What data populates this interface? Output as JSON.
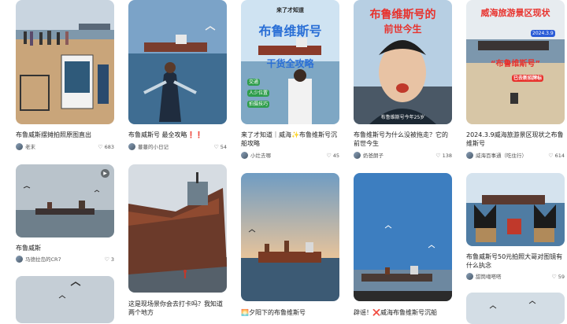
{
  "feed": {
    "columns": [
      {
        "cards": [
          {
            "title": "布鲁威斯摆摊拍照原图直出",
            "author": "老末",
            "likes": "683"
          },
          {
            "title": "布鲁威斯",
            "author": "马德拉岛的CR7",
            "likes": "3"
          },
          {
            "title": "",
            "author": "",
            "likes": ""
          }
        ]
      },
      {
        "cards": [
          {
            "title": "布鲁威斯号 最全攻略❗️❗️",
            "author": "蔓蔓的小日记",
            "likes": "54"
          },
          {
            "title": "这是现场景你会去打卡吗？我知道两个地方",
            "author": "",
            "likes": ""
          }
        ]
      },
      {
        "cards": [
          {
            "title": "来了才知道｜威海✨布鲁维斯号沉船攻略",
            "author": "小灶去哪",
            "likes": "45",
            "overlay": {
              "top": "来了才知道",
              "main": "布鲁维斯号",
              "sub": "干货全攻略",
              "bullets": [
                "交通",
                "人少位置",
                "拍摄技巧"
              ]
            }
          },
          {
            "title": "🌅夕阳下的布鲁维斯号",
            "author": "",
            "likes": ""
          }
        ]
      },
      {
        "cards": [
          {
            "title": "布鲁维斯号为什么没被拖走？它的前世今生",
            "author": "奶爸朗子",
            "likes": "138",
            "overlay": {
              "main": "布鲁维斯号的",
              "sub": "前世今生",
              "caption": "布鲁维斯号今年25岁"
            }
          },
          {
            "title": "辟谣！❌威海布鲁维斯号沉船",
            "author": "",
            "likes": ""
          }
        ]
      },
      {
        "cards": [
          {
            "title": "2024.3.9威海旅游景区现状之布鲁维斯号",
            "author": "威海百事通（吃住行）",
            "likes": "614",
            "overlay": {
              "main": "威海旅游景区现状",
              "date": "2024.3.9",
              "sub": "“布鲁维斯号”",
              "tag": "已去新招牌标"
            }
          },
          {
            "title": "布鲁威斯号50元拍照大哥对图镜有什么执念",
            "author": "甜筒噶嗒嗒",
            "likes": "59"
          },
          {
            "title": "",
            "author": "",
            "likes": ""
          }
        ]
      }
    ]
  },
  "colors": {
    "accent_red": "#e8322d",
    "text": "#222222",
    "meta": "#555555"
  }
}
